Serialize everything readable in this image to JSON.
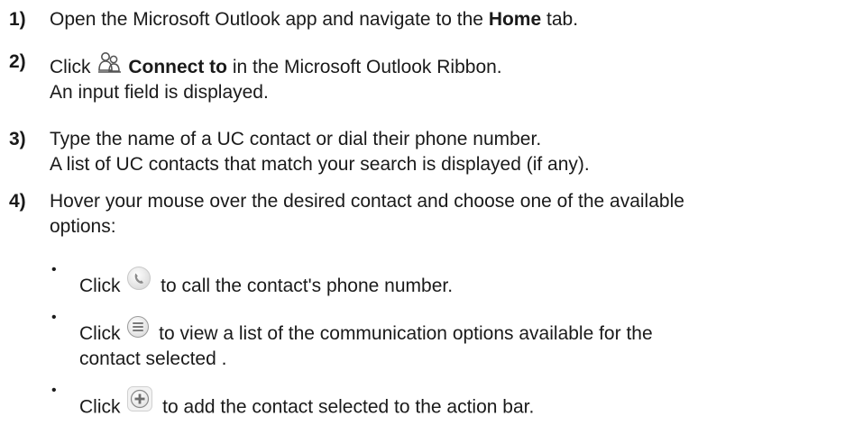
{
  "steps": [
    {
      "number": "1)",
      "text_before": "Open the Microsoft Outlook app and navigate to the ",
      "bold": "Home",
      "text_after": " tab."
    },
    {
      "number": "2)",
      "click": "Click ",
      "bold": "Connect to",
      "text_after": " in the Microsoft Outlook Ribbon.",
      "line2": "An input field is displayed.",
      "icon": "connect-to-icon"
    },
    {
      "number": "3)",
      "line1": "Type the name of a UC contact or dial their phone number.",
      "line2": "A list of UC contacts that match your search is displayed (if any)."
    },
    {
      "number": "4)",
      "line1": "Hover your mouse over the desired contact and choose one of the available",
      "line2": "options:"
    }
  ],
  "options": [
    {
      "bullet": "•",
      "click": "Click ",
      "text": " to call the contact's phone number.",
      "icon": "phone-icon"
    },
    {
      "bullet": "•",
      "click": "Click ",
      "text": " to view a list of the communication options available for the",
      "line2": "contact selected .",
      "icon": "menu-icon"
    },
    {
      "bullet": "•",
      "click": "Click ",
      "text": " to add the contact selected to the action bar.",
      "icon": "add-icon"
    }
  ]
}
